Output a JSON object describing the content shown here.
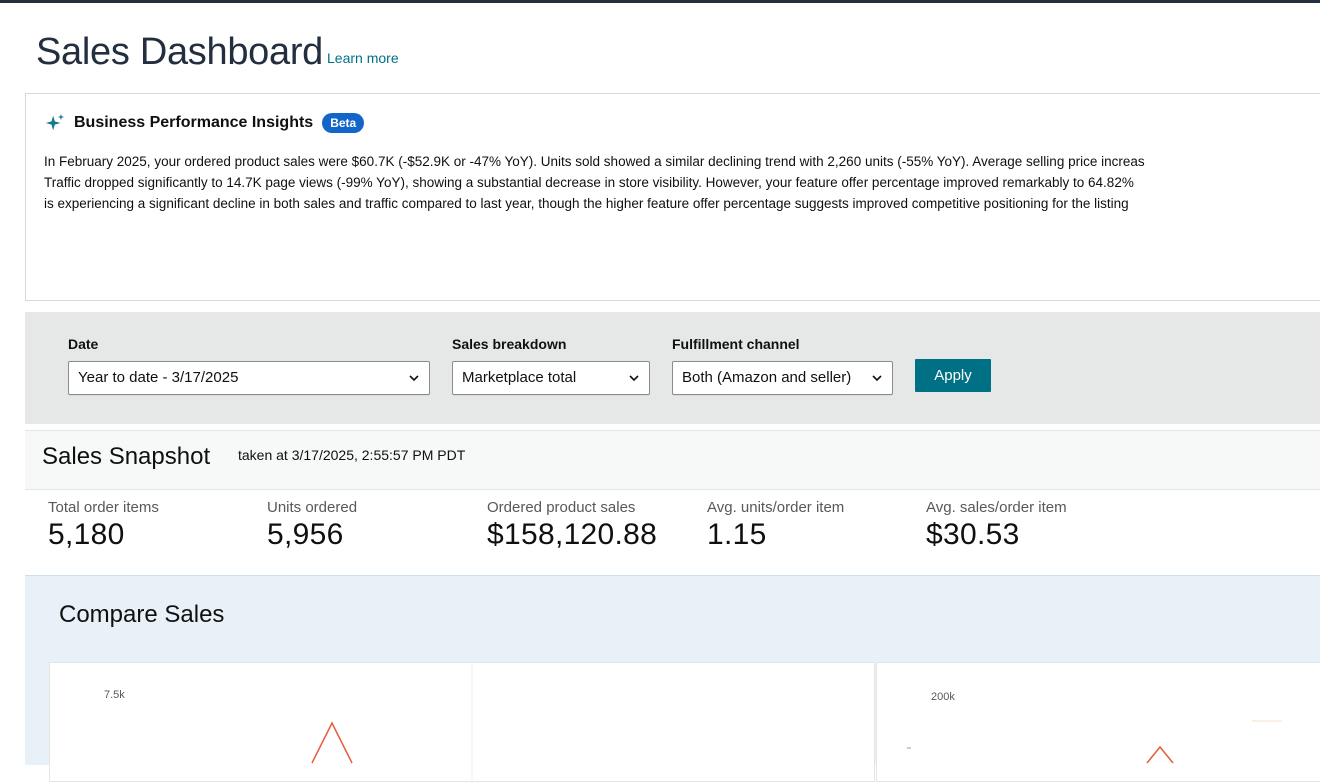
{
  "header": {
    "title": "Sales Dashboard",
    "learn_more": "Learn more"
  },
  "insights": {
    "icon": "sparkle-icon",
    "title": "Business Performance Insights",
    "badge": "Beta",
    "lines": [
      "In February 2025, your ordered product sales were $60.7K (-$52.9K or -47% YoY). Units sold showed a similar declining trend with 2,260 units (-55% YoY). Average selling price increas",
      "Traffic dropped significantly to 14.7K page views (-99% YoY), showing a substantial decrease in store visibility. However, your feature offer percentage improved remarkably to 64.82%",
      "is experiencing a significant decline in both sales and traffic compared to last year, though the higher feature offer percentage suggests improved competitive positioning for the listing"
    ]
  },
  "filters": {
    "date_label": "Date",
    "date_value": "Year to date - 3/17/2025",
    "breakdown_label": "Sales breakdown",
    "breakdown_value": "Marketplace total",
    "channel_label": "Fulfillment channel",
    "channel_value": "Both (Amazon and seller)",
    "apply_label": "Apply"
  },
  "snapshot": {
    "title": "Sales Snapshot",
    "taken_at": "taken at 3/17/2025, 2:55:57 PM PDT",
    "metrics": [
      {
        "label": "Total order items",
        "value": "5,180"
      },
      {
        "label": "Units ordered",
        "value": "5,956"
      },
      {
        "label": "Ordered product sales",
        "value": "$158,120.88"
      },
      {
        "label": "Avg. units/order item",
        "value": "1.15"
      },
      {
        "label": "Avg. sales/order item",
        "value": "$30.53"
      }
    ]
  },
  "compare": {
    "title": "Compare Sales",
    "chart_left_tick": "7.5k",
    "chart_right_tick": "200k"
  },
  "colors": {
    "accent": "#007185",
    "badge": "#1366c9",
    "chart_line": "#e35d3d"
  }
}
